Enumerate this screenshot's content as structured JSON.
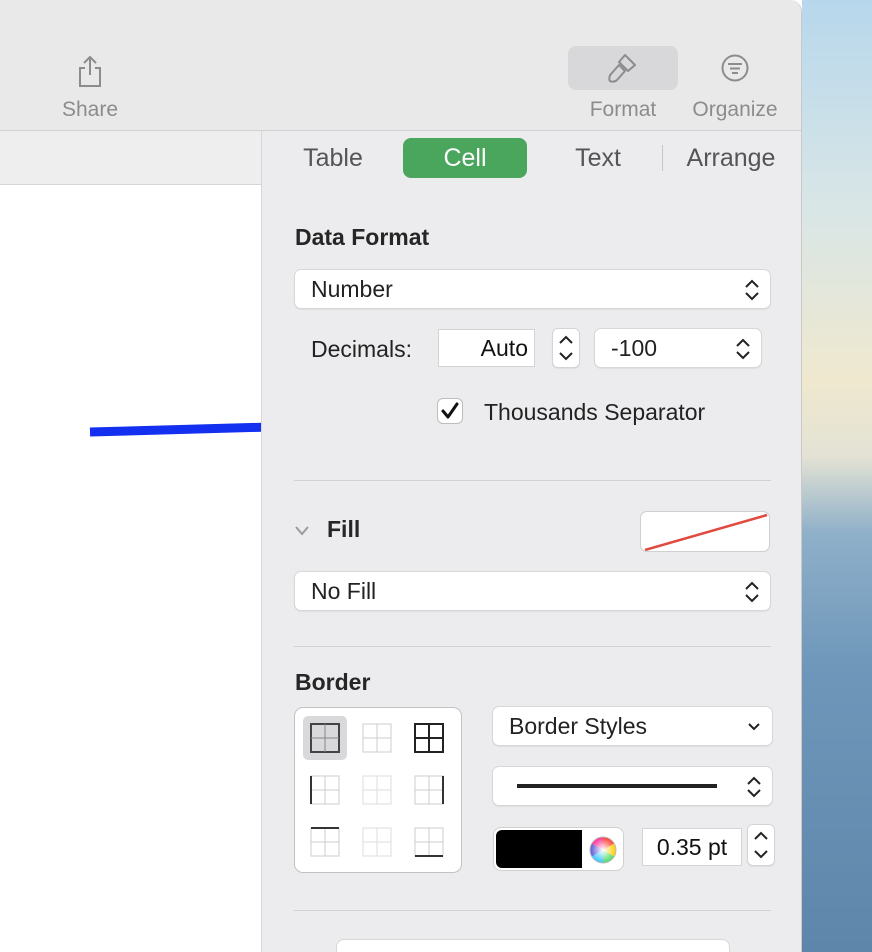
{
  "toolbar": {
    "share_label": "Share",
    "format_label": "Format",
    "organize_label": "Organize"
  },
  "inspector": {
    "tabs": [
      {
        "label": "Table",
        "active": false
      },
      {
        "label": "Cell",
        "active": true
      },
      {
        "label": "Text",
        "active": false
      },
      {
        "label": "Arrange",
        "active": false
      }
    ],
    "data_format": {
      "title": "Data Format",
      "format_value": "Number",
      "decimals_label": "Decimals:",
      "decimals_value": "Auto",
      "negative_format_value": "-100",
      "thousands_label": "Thousands Separator",
      "thousands_checked": true
    },
    "fill": {
      "title": "Fill",
      "fill_value": "No Fill"
    },
    "border": {
      "title": "Border",
      "style_preset_value": "Border Styles",
      "line_style": "solid",
      "color": "#000000",
      "width_value": "0.35 pt"
    }
  },
  "colors": {
    "accent_tab": "#4aa55d",
    "annotation_arrow": "#1330f0",
    "no_fill_slash": "#e04a3f"
  },
  "icons": [
    "share-icon",
    "format-paintbrush-icon",
    "organize-icon",
    "chevron-updown-icon",
    "chevron-down-icon",
    "checkmark-icon",
    "color-wheel-icon",
    "arrow-annotation"
  ]
}
